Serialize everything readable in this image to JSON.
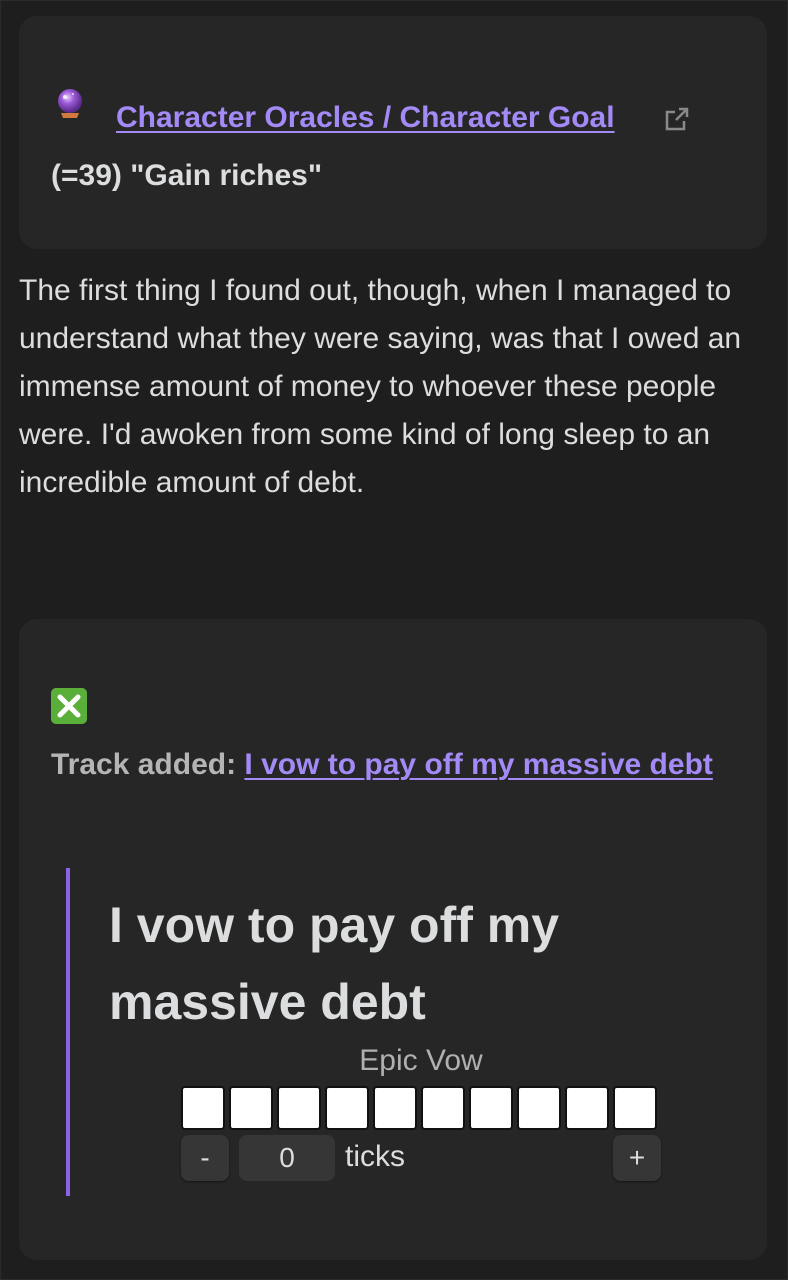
{
  "oracle": {
    "link_text": "Character Oracles / Character Goal",
    "result": "(=39) \"Gain riches\"",
    "icon": "crystal-ball-icon",
    "link_icon": "external-link-icon"
  },
  "prose": "The first thing I found out, though, when I managed to understand what they were saying, was that I owed an immense amount of money to whoever these people were. I'd awoken from some kind of long sleep to an incredible amount of debt.",
  "track": {
    "icon": "cross-mark-icon",
    "label": "Track added:",
    "link_text": "I vow to pay off my massive debt",
    "title": "I vow to pay off my massive debt",
    "rank": "Epic Vow",
    "boxes_filled": 0,
    "boxes_total": 10,
    "minus_label": "-",
    "plus_label": "+",
    "ticks_value": "0",
    "ticks_label": "ticks"
  },
  "colors": {
    "background": "#1e1e1e",
    "card": "#262626",
    "accent": "#a48af6",
    "quote_bar": "#8a63e6",
    "check_green": "#5aae3a"
  }
}
